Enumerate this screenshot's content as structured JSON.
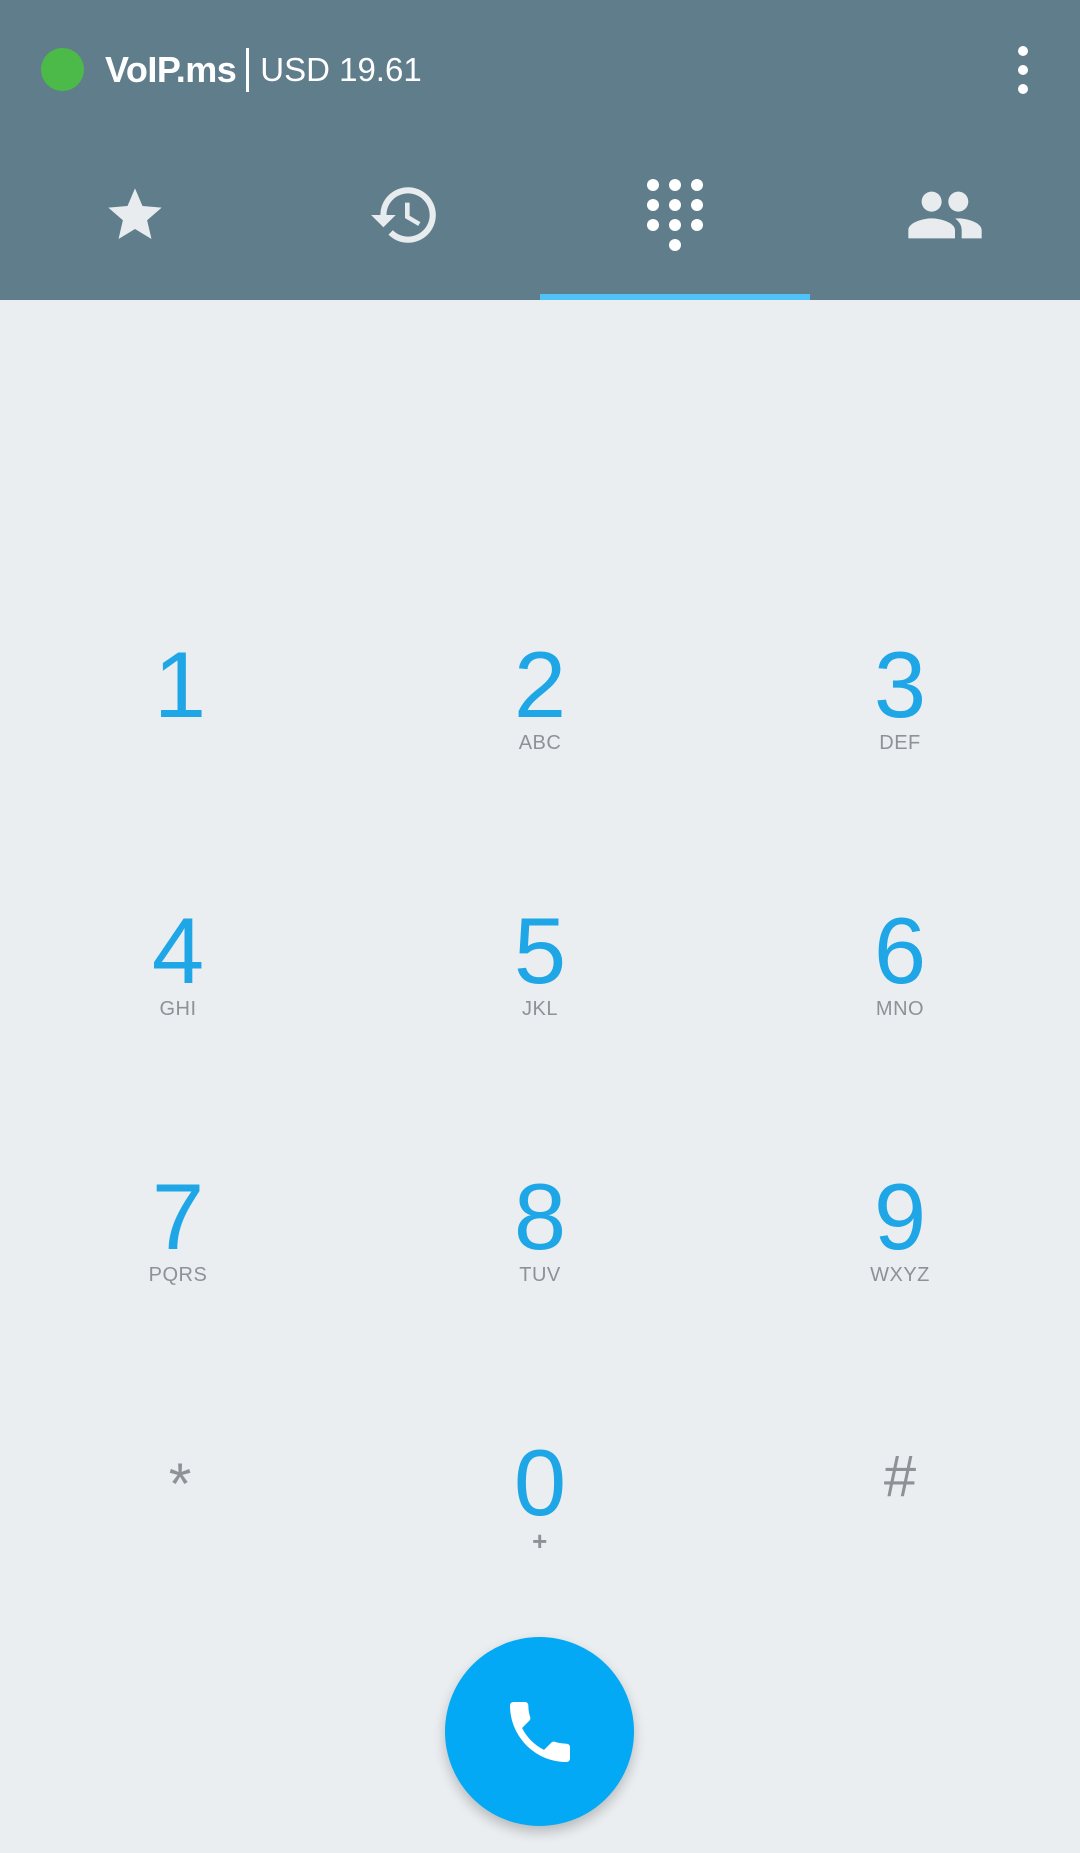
{
  "header": {
    "app_name": "VoIP.ms",
    "balance": "USD 19.61",
    "status_color": "#4cba49",
    "background_color": "#607d8b"
  },
  "tabs": [
    {
      "name": "favorites",
      "icon": "star-icon",
      "selected": false
    },
    {
      "name": "history",
      "icon": "history-icon",
      "selected": false
    },
    {
      "name": "dialpad",
      "icon": "dialpad-icon",
      "selected": true
    },
    {
      "name": "contacts",
      "icon": "contacts-icon",
      "selected": false
    }
  ],
  "accent_color": "#4fc3f7",
  "dialpad": {
    "keys": [
      {
        "digit": "1",
        "letters": ""
      },
      {
        "digit": "2",
        "letters": "ABC"
      },
      {
        "digit": "3",
        "letters": "DEF"
      },
      {
        "digit": "4",
        "letters": "GHI"
      },
      {
        "digit": "5",
        "letters": "JKL"
      },
      {
        "digit": "6",
        "letters": "MNO"
      },
      {
        "digit": "7",
        "letters": "PQRS"
      },
      {
        "digit": "8",
        "letters": "TUV"
      },
      {
        "digit": "9",
        "letters": "WXYZ"
      },
      {
        "digit": "*",
        "letters": ""
      },
      {
        "digit": "0",
        "letters": "+"
      },
      {
        "digit": "#",
        "letters": ""
      }
    ],
    "digit_color": "#1ea6e6",
    "letters_color": "#8d9297"
  },
  "call_button": {
    "icon": "phone-icon",
    "color": "#03a9f4"
  }
}
